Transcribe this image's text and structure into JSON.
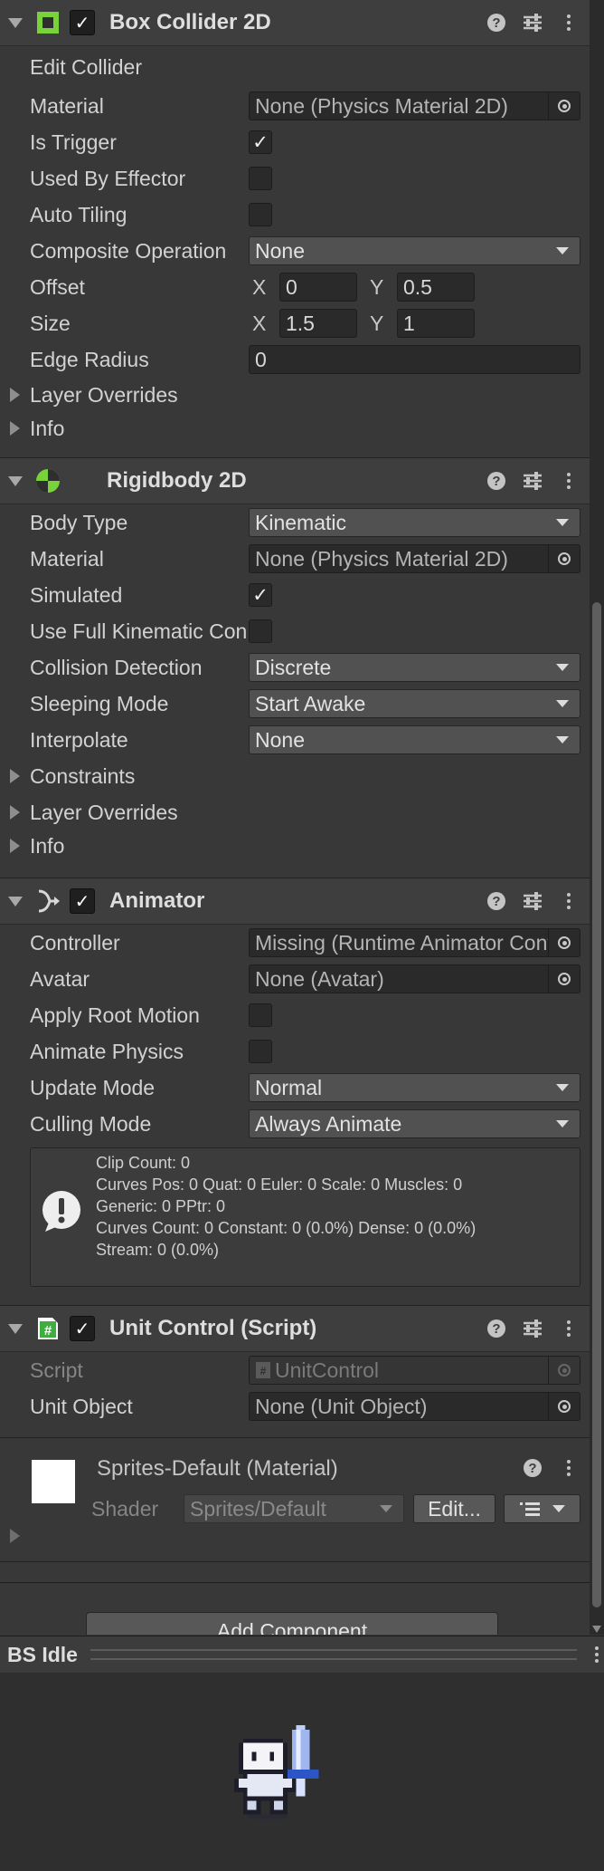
{
  "box_collider": {
    "title": "Box Collider 2D",
    "edit_collider": "Edit Collider",
    "material_label": "Material",
    "material_value": "None (Physics Material 2D)",
    "is_trigger_label": "Is Trigger",
    "is_trigger": true,
    "used_by_effector_label": "Used By Effector",
    "used_by_effector": false,
    "auto_tiling_label": "Auto Tiling",
    "auto_tiling": false,
    "composite_label": "Composite Operation",
    "composite_value": "None",
    "offset_label": "Offset",
    "offset_x": "0",
    "offset_y": "0.5",
    "size_label": "Size",
    "size_x": "1.5",
    "size_y": "1",
    "edge_radius_label": "Edge Radius",
    "edge_radius": "0",
    "layer_overrides": "Layer Overrides",
    "info": "Info"
  },
  "rigidbody": {
    "title": "Rigidbody 2D",
    "body_type_label": "Body Type",
    "body_type": "Kinematic",
    "material_label": "Material",
    "material_value": "None (Physics Material 2D)",
    "simulated_label": "Simulated",
    "simulated": true,
    "full_kinematic_label": "Use Full Kinematic Contacts",
    "full_kinematic": false,
    "collision_label": "Collision Detection",
    "collision_value": "Discrete",
    "sleeping_label": "Sleeping Mode",
    "sleeping_value": "Start Awake",
    "interpolate_label": "Interpolate",
    "interpolate_value": "None",
    "constraints": "Constraints",
    "layer_overrides": "Layer Overrides",
    "info": "Info"
  },
  "animator": {
    "title": "Animator",
    "controller_label": "Controller",
    "controller_value": "Missing (Runtime Animator Controller)",
    "avatar_label": "Avatar",
    "avatar_value": "None (Avatar)",
    "apply_root_label": "Apply Root Motion",
    "apply_root": false,
    "animate_physics_label": "Animate Physics",
    "animate_physics": false,
    "update_mode_label": "Update Mode",
    "update_mode": "Normal",
    "culling_mode_label": "Culling Mode",
    "culling_mode": "Always Animate",
    "help_text": "Clip Count: 0\nCurves Pos: 0 Quat: 0 Euler: 0 Scale: 0 Muscles: 0\nGeneric: 0 PPtr: 0\nCurves Count: 0 Constant: 0 (0.0%) Dense: 0 (0.0%)\nStream: 0 (0.0%)"
  },
  "unit_control": {
    "title": "Unit Control (Script)",
    "script_label": "Script",
    "script_value": "UnitControl",
    "unit_object_label": "Unit Object",
    "unit_object_value": "None (Unit Object)"
  },
  "material": {
    "title": "Sprites-Default (Material)",
    "shader_label": "Shader",
    "shader_value": "Sprites/Default",
    "edit_label": "Edit..."
  },
  "add_component": "Add Component",
  "preview": {
    "title": "BS Idle"
  },
  "icons": {
    "help": "help-icon",
    "presets": "presets-icon",
    "more": "more-icon"
  }
}
